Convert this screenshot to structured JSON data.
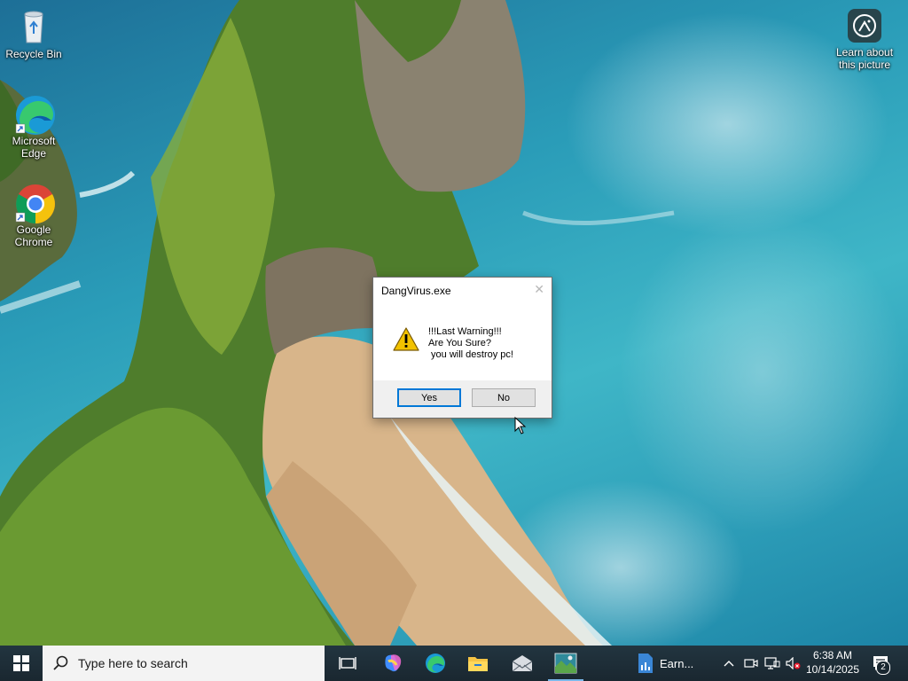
{
  "desktop": {
    "icons": [
      {
        "label": "Recycle Bin",
        "icon": "recycle-bin-icon"
      },
      {
        "label": "Microsoft Edge",
        "icon": "edge-icon"
      },
      {
        "label": "Google Chrome",
        "icon": "chrome-icon"
      }
    ],
    "learn": {
      "label": "Learn about this picture",
      "icon": "camera-icon"
    }
  },
  "dialog": {
    "title": "DangVirus.exe",
    "close_glyph": "✕",
    "icon": "warning-icon",
    "message": "!!!Last Warning!!!\nAre You Sure?\n you will destroy pc!",
    "yes_label": "Yes",
    "no_label": "No"
  },
  "taskbar": {
    "start_icon": "windows-start-icon",
    "search_placeholder": "Type here to search",
    "task_view_icon": "task-view-icon",
    "apps": [
      {
        "name": "copilot",
        "icon": "copilot-icon"
      },
      {
        "name": "edge",
        "icon": "edge-icon"
      },
      {
        "name": "file-explorer",
        "icon": "folder-icon"
      },
      {
        "name": "mail",
        "icon": "mail-icon"
      },
      {
        "name": "photo",
        "icon": "picture-icon",
        "active": true
      }
    ],
    "widget_label": "Earn...",
    "tray": {
      "time": "6:38 AM",
      "date": "10/14/2025",
      "notification_count": "2"
    }
  },
  "colors": {
    "taskbar": "#1a2730",
    "accent": "#0078d7",
    "warning": "#f2c200"
  }
}
